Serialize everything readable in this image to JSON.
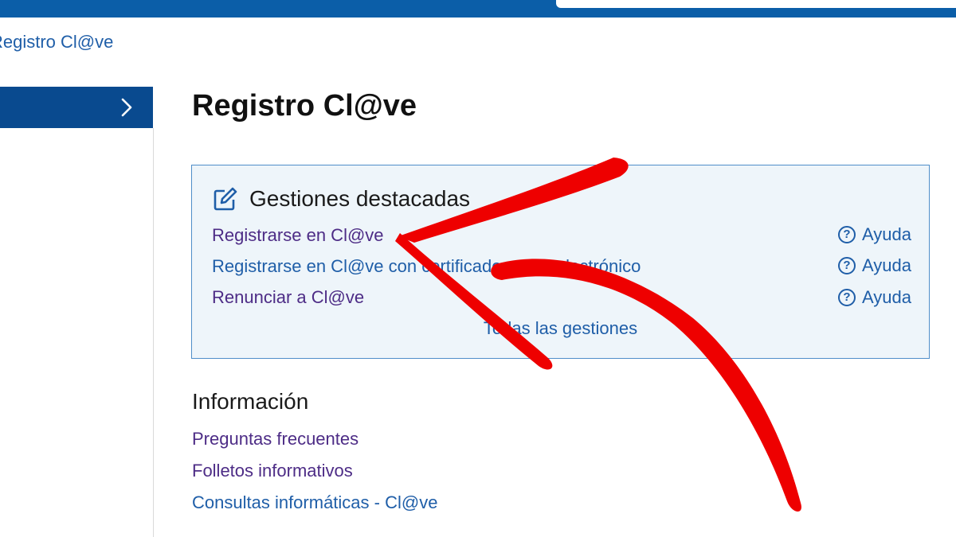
{
  "breadcrumb": {
    "current": "Registro Cl@ve"
  },
  "page": {
    "title": "Registro Cl@ve"
  },
  "featured": {
    "title": "Gestiones destacadas",
    "icon": "edit-icon",
    "items": [
      {
        "label": "Registrarse en Cl@ve",
        "help_label": "Ayuda"
      },
      {
        "label": "Registrarse en Cl@ve con certificado o DNI electrónico",
        "help_label": "Ayuda"
      },
      {
        "label": "Renunciar a Cl@ve",
        "help_label": "Ayuda"
      }
    ],
    "all_label": "Todas las gestiones"
  },
  "info": {
    "title": "Información",
    "links": [
      {
        "label": "Preguntas frecuentes"
      },
      {
        "label": "Folletos informativos"
      },
      {
        "label": "Consultas informáticas - Cl@ve"
      }
    ]
  },
  "colors": {
    "header_blue": "#0b5ea8",
    "nav_active": "#094a8f",
    "link_blue": "#1f5ea8",
    "link_visited": "#4d2c86",
    "box_background": "#eef5fa",
    "box_border": "#4f8ec9",
    "annotation_arrow": "#ee0000"
  }
}
